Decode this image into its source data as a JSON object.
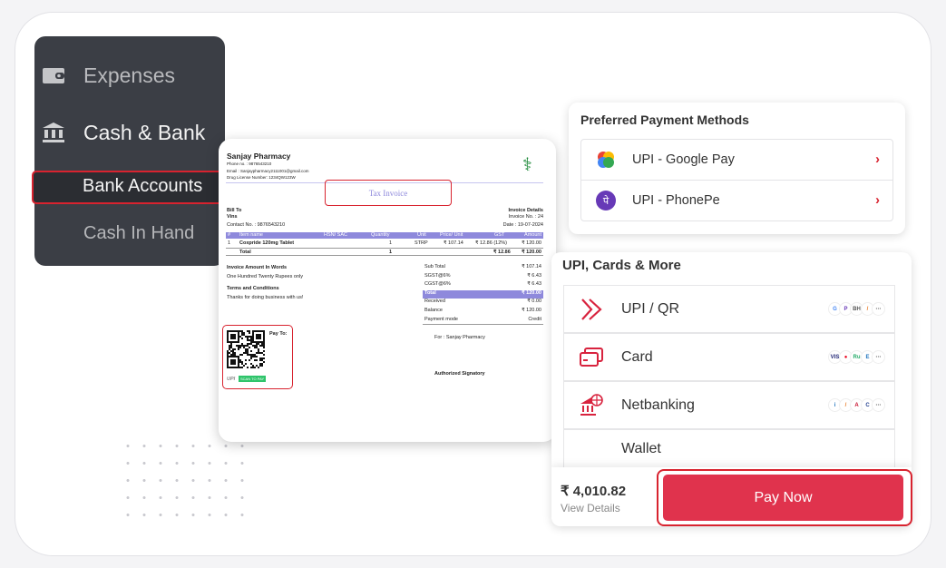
{
  "sidebar": {
    "items": [
      {
        "label": "Expenses",
        "icon": "wallet-icon"
      },
      {
        "label": "Cash & Bank",
        "icon": "bank-icon"
      },
      {
        "label": "Bank Accounts"
      },
      {
        "label": "Cash In Hand"
      }
    ]
  },
  "invoice": {
    "business": "Sanjay Pharmacy",
    "phone": "Phone no. : 9876543210",
    "email": "Email : Sanjaypharmacy2111001@gmail.com",
    "license": "Drug License Number: 1234QW123W",
    "title": "Tax Invoice",
    "bill_to": "Bill To",
    "customer": "Vins",
    "contact": "Contact No. : 9876543210",
    "details_label": "Invoice Details",
    "invoice_no": "Invoice No. : 24",
    "date": "Date : 19-07-2024",
    "columns": [
      "#",
      "Item name",
      "HSN/ SAC",
      "Quantity",
      "Unit",
      "Price/ Unit",
      "GST",
      "Amount"
    ],
    "row": [
      "1",
      "Coxpride 120mg Tablet",
      "",
      "1",
      "STRP",
      "₹ 107.14",
      "₹ 12.86 (12%)",
      "₹ 120.00"
    ],
    "total_row": [
      "",
      "Total",
      "",
      "1",
      "",
      "",
      "₹ 12.86",
      "₹ 120.00"
    ],
    "words_label": "Invoice Amount In Words",
    "words": "One Hundred Twenty Rupees only",
    "terms_label": "Terms and Conditions",
    "terms": "Thanks for doing business with us!",
    "summary": [
      [
        "Sub Total",
        "₹ 107.14"
      ],
      [
        "SGST@6%",
        "₹ 6.43"
      ],
      [
        "CGST@6%",
        "₹ 6.43"
      ],
      [
        "Total",
        "₹ 120.00"
      ],
      [
        "Received",
        "₹ 0.00"
      ],
      [
        "Balance",
        "₹ 120.00"
      ],
      [
        "Payment mode",
        "Credit"
      ]
    ],
    "pay_to": "Pay To:",
    "upi": "UPI",
    "scan": "SCAN TO PAY",
    "for": "For : Sanjay Pharmacy",
    "signatory": "Authorized Signatory"
  },
  "preferred": {
    "title": "Preferred Payment Methods",
    "items": [
      {
        "label": "UPI - Google Pay",
        "icon": "google-pay-icon"
      },
      {
        "label": "UPI - PhonePe",
        "icon": "phonepe-icon"
      }
    ]
  },
  "more": {
    "title": "UPI, Cards & More",
    "items": [
      {
        "label": "UPI / QR",
        "icon": "upi-icon"
      },
      {
        "label": "Card",
        "icon": "card-icon"
      },
      {
        "label": "Netbanking",
        "icon": "bank-globe-icon"
      },
      {
        "label": "Wallet",
        "icon": "wallet-icon"
      }
    ],
    "more_badge": "···"
  },
  "footer": {
    "amount": "₹ 4,010.82",
    "view_details": "View Details",
    "pay_now": "Pay Now"
  },
  "colors": {
    "accent": "#e0334d",
    "sidebar": "#3b3e45",
    "invoice_header": "#8e89dc",
    "highlight": "#d8232f"
  }
}
